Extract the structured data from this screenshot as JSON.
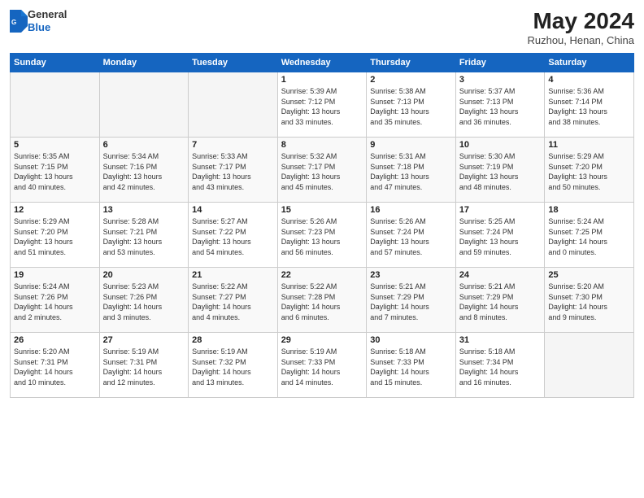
{
  "header": {
    "logo": {
      "general": "General",
      "blue": "Blue"
    },
    "title": "May 2024",
    "location": "Ruzhou, Henan, China"
  },
  "weekdays": [
    "Sunday",
    "Monday",
    "Tuesday",
    "Wednesday",
    "Thursday",
    "Friday",
    "Saturday"
  ],
  "weeks": [
    [
      {
        "day": "",
        "info": ""
      },
      {
        "day": "",
        "info": ""
      },
      {
        "day": "",
        "info": ""
      },
      {
        "day": "1",
        "info": "Sunrise: 5:39 AM\nSunset: 7:12 PM\nDaylight: 13 hours\nand 33 minutes."
      },
      {
        "day": "2",
        "info": "Sunrise: 5:38 AM\nSunset: 7:13 PM\nDaylight: 13 hours\nand 35 minutes."
      },
      {
        "day": "3",
        "info": "Sunrise: 5:37 AM\nSunset: 7:13 PM\nDaylight: 13 hours\nand 36 minutes."
      },
      {
        "day": "4",
        "info": "Sunrise: 5:36 AM\nSunset: 7:14 PM\nDaylight: 13 hours\nand 38 minutes."
      }
    ],
    [
      {
        "day": "5",
        "info": "Sunrise: 5:35 AM\nSunset: 7:15 PM\nDaylight: 13 hours\nand 40 minutes."
      },
      {
        "day": "6",
        "info": "Sunrise: 5:34 AM\nSunset: 7:16 PM\nDaylight: 13 hours\nand 42 minutes."
      },
      {
        "day": "7",
        "info": "Sunrise: 5:33 AM\nSunset: 7:17 PM\nDaylight: 13 hours\nand 43 minutes."
      },
      {
        "day": "8",
        "info": "Sunrise: 5:32 AM\nSunset: 7:17 PM\nDaylight: 13 hours\nand 45 minutes."
      },
      {
        "day": "9",
        "info": "Sunrise: 5:31 AM\nSunset: 7:18 PM\nDaylight: 13 hours\nand 47 minutes."
      },
      {
        "day": "10",
        "info": "Sunrise: 5:30 AM\nSunset: 7:19 PM\nDaylight: 13 hours\nand 48 minutes."
      },
      {
        "day": "11",
        "info": "Sunrise: 5:29 AM\nSunset: 7:20 PM\nDaylight: 13 hours\nand 50 minutes."
      }
    ],
    [
      {
        "day": "12",
        "info": "Sunrise: 5:29 AM\nSunset: 7:20 PM\nDaylight: 13 hours\nand 51 minutes."
      },
      {
        "day": "13",
        "info": "Sunrise: 5:28 AM\nSunset: 7:21 PM\nDaylight: 13 hours\nand 53 minutes."
      },
      {
        "day": "14",
        "info": "Sunrise: 5:27 AM\nSunset: 7:22 PM\nDaylight: 13 hours\nand 54 minutes."
      },
      {
        "day": "15",
        "info": "Sunrise: 5:26 AM\nSunset: 7:23 PM\nDaylight: 13 hours\nand 56 minutes."
      },
      {
        "day": "16",
        "info": "Sunrise: 5:26 AM\nSunset: 7:24 PM\nDaylight: 13 hours\nand 57 minutes."
      },
      {
        "day": "17",
        "info": "Sunrise: 5:25 AM\nSunset: 7:24 PM\nDaylight: 13 hours\nand 59 minutes."
      },
      {
        "day": "18",
        "info": "Sunrise: 5:24 AM\nSunset: 7:25 PM\nDaylight: 14 hours\nand 0 minutes."
      }
    ],
    [
      {
        "day": "19",
        "info": "Sunrise: 5:24 AM\nSunset: 7:26 PM\nDaylight: 14 hours\nand 2 minutes."
      },
      {
        "day": "20",
        "info": "Sunrise: 5:23 AM\nSunset: 7:26 PM\nDaylight: 14 hours\nand 3 minutes."
      },
      {
        "day": "21",
        "info": "Sunrise: 5:22 AM\nSunset: 7:27 PM\nDaylight: 14 hours\nand 4 minutes."
      },
      {
        "day": "22",
        "info": "Sunrise: 5:22 AM\nSunset: 7:28 PM\nDaylight: 14 hours\nand 6 minutes."
      },
      {
        "day": "23",
        "info": "Sunrise: 5:21 AM\nSunset: 7:29 PM\nDaylight: 14 hours\nand 7 minutes."
      },
      {
        "day": "24",
        "info": "Sunrise: 5:21 AM\nSunset: 7:29 PM\nDaylight: 14 hours\nand 8 minutes."
      },
      {
        "day": "25",
        "info": "Sunrise: 5:20 AM\nSunset: 7:30 PM\nDaylight: 14 hours\nand 9 minutes."
      }
    ],
    [
      {
        "day": "26",
        "info": "Sunrise: 5:20 AM\nSunset: 7:31 PM\nDaylight: 14 hours\nand 10 minutes."
      },
      {
        "day": "27",
        "info": "Sunrise: 5:19 AM\nSunset: 7:31 PM\nDaylight: 14 hours\nand 12 minutes."
      },
      {
        "day": "28",
        "info": "Sunrise: 5:19 AM\nSunset: 7:32 PM\nDaylight: 14 hours\nand 13 minutes."
      },
      {
        "day": "29",
        "info": "Sunrise: 5:19 AM\nSunset: 7:33 PM\nDaylight: 14 hours\nand 14 minutes."
      },
      {
        "day": "30",
        "info": "Sunrise: 5:18 AM\nSunset: 7:33 PM\nDaylight: 14 hours\nand 15 minutes."
      },
      {
        "day": "31",
        "info": "Sunrise: 5:18 AM\nSunset: 7:34 PM\nDaylight: 14 hours\nand 16 minutes."
      },
      {
        "day": "",
        "info": ""
      }
    ]
  ]
}
